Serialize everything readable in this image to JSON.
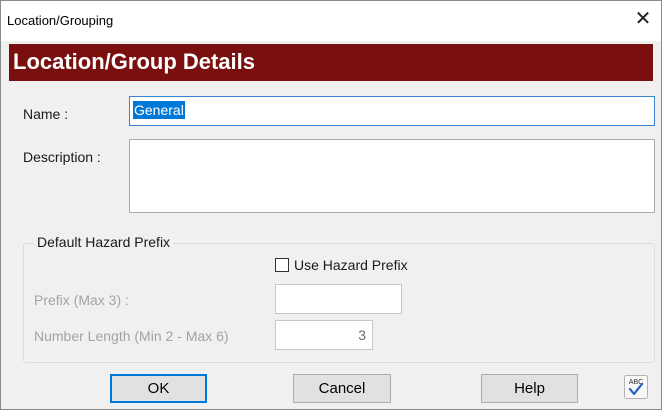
{
  "window": {
    "title": "Location/Grouping",
    "close_glyph": "✕"
  },
  "banner": {
    "heading": "Location/Group Details",
    "color": "#7a0f0f"
  },
  "form": {
    "name_label": "Name :",
    "name_value": "General",
    "description_label": "Description :",
    "description_value": ""
  },
  "hazard_group": {
    "title": "Default Hazard Prefix",
    "use_prefix_label": "Use Hazard Prefix",
    "use_prefix_checked": false,
    "prefix_label": "Prefix (Max 3) :",
    "prefix_value": "",
    "number_length_label": "Number Length (Min 2 - Max 6)",
    "number_length_value": "3"
  },
  "buttons": {
    "ok": "OK",
    "cancel": "Cancel",
    "help": "Help",
    "spellcheck_icon": "spell-check-icon",
    "spellcheck_text": "ABC"
  },
  "colors": {
    "selection": "#0078d7",
    "focus_border": "#3a86d4"
  }
}
